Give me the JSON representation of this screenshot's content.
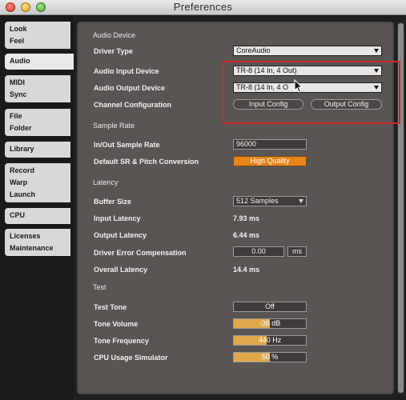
{
  "window": {
    "title": "Preferences"
  },
  "tabs": [
    {
      "lines": [
        "Look",
        "Feel"
      ]
    },
    {
      "lines": [
        "Audio"
      ]
    },
    {
      "lines": [
        "MIDI",
        "Sync"
      ]
    },
    {
      "lines": [
        "File",
        "Folder"
      ]
    },
    {
      "lines": [
        "Library"
      ]
    },
    {
      "lines": [
        "Record",
        "Warp",
        "Launch"
      ]
    },
    {
      "lines": [
        "CPU"
      ]
    },
    {
      "lines": [
        "Licenses",
        "Maintenance"
      ]
    }
  ],
  "active_tab": "Audio",
  "audio_device": {
    "section": "Audio Device",
    "driver_type_label": "Driver Type",
    "driver_type_value": "CoreAudio",
    "input_device_label": "Audio Input Device",
    "input_device_value": "TR-8 (14 In, 4 Out)",
    "output_device_label": "Audio Output Device",
    "output_device_value": "TR-8 (14 In, 4 O",
    "channel_config_label": "Channel Configuration",
    "input_config_button": "Input Config",
    "output_config_button": "Output Config"
  },
  "sample_rate": {
    "section": "Sample Rate",
    "io_rate_label": "In/Out Sample Rate",
    "io_rate_value": "96000",
    "conversion_label": "Default SR & Pitch Conversion",
    "conversion_value": "High Quality"
  },
  "latency": {
    "section": "Latency",
    "buffer_size_label": "Buffer Size",
    "buffer_size_value": "512 Samples",
    "input_latency_label": "Input Latency",
    "input_latency_value": "7.93 ms",
    "output_latency_label": "Output Latency",
    "output_latency_value": "6.44 ms",
    "driver_error_label": "Driver Error Compensation",
    "driver_error_value": "0.00",
    "driver_error_unit": "ms",
    "overall_latency_label": "Overall Latency",
    "overall_latency_value": "14.4 ms"
  },
  "test": {
    "section": "Test",
    "test_tone_label": "Test Tone",
    "test_tone_value": "Off",
    "tone_volume_label": "Tone Volume",
    "tone_volume_value": "-36 dB",
    "tone_volume_level": 0.5,
    "tone_frequency_label": "Tone Frequency",
    "tone_frequency_value": "440 Hz",
    "tone_frequency_level": 0.45,
    "cpu_sim_label": "CPU Usage Simulator",
    "cpu_sim_value": "50 %",
    "cpu_sim_level": 0.5
  },
  "colors": {
    "highlight_box": "#d0262c",
    "orange_button": "#e8841a",
    "slider_fill": "#e0a84a"
  }
}
